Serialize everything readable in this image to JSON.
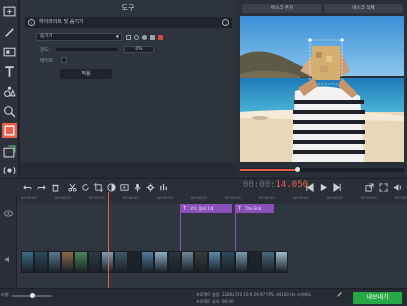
{
  "panel": {
    "title": "도구",
    "section_label": "하이라이트 및 숨기기",
    "mode_value": "숨기기",
    "strength_label": "강도:",
    "strength_value": "0%",
    "strength_fraction": 0.0,
    "border_label": "테두리:",
    "apply_label": "적용"
  },
  "preview": {
    "add_button_label": "마스크 추가",
    "remove_button_label": "마스크 삭제",
    "progress_fraction": 0.35
  },
  "transport": {
    "timecode_dim": "00:00:",
    "timecode_hi": "14.050"
  },
  "ruler": {
    "ticks": [
      "00:00:00",
      "00:00:05",
      "00:00:10",
      "00:00:15",
      "00:00:20",
      "00:00:25",
      "00:00:30",
      "00:00:35",
      "00:00:40",
      "00:00:45",
      "00:00:50",
      "00:00:55"
    ]
  },
  "titles": [
    {
      "label": "로드 플레 1개"
    },
    {
      "label": "The End"
    }
  ],
  "status": {
    "zoom_label": "비율:",
    "project_settings": "프로젝트 설정: 1280x720 16:9 29.97 FPS, 44100 Hz 스테레오",
    "project_length": "프로젝트 길이: 00:40",
    "export_label": "내보내기"
  }
}
